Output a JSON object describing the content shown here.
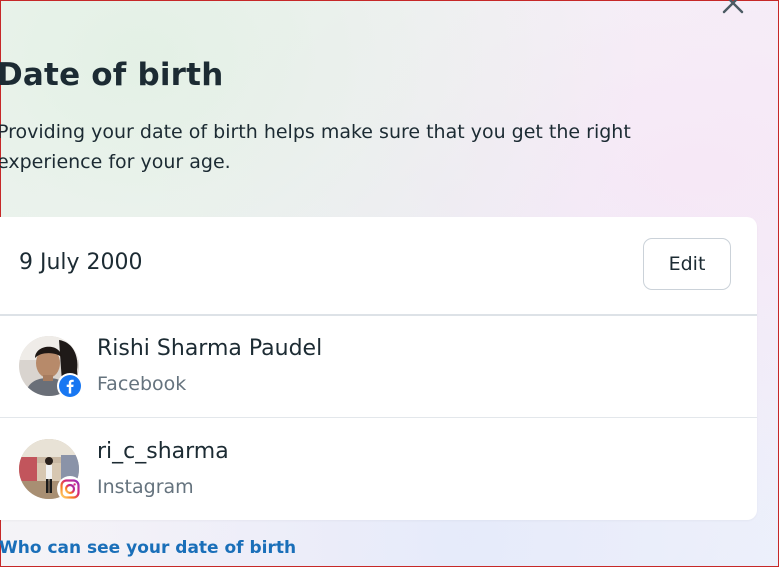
{
  "dialog": {
    "title": "Date of birth",
    "description": "Providing your date of birth helps make sure that you get the right experience for your age.",
    "close_icon": "close-icon"
  },
  "dob": {
    "value": "9 July 2000",
    "edit_label": "Edit"
  },
  "accounts": [
    {
      "name": "Rishi Sharma Paudel",
      "platform": "Facebook",
      "badge_icon": "facebook-icon"
    },
    {
      "name": "ri_c_sharma",
      "platform": "Instagram",
      "badge_icon": "instagram-icon"
    }
  ],
  "footer": {
    "link_label": "Who can see your date of birth"
  },
  "colors": {
    "text": "#1c2b33",
    "muted": "#65737e",
    "link": "#1a6fb9",
    "facebook": "#1877f2",
    "instagram": "#e1306c",
    "window_border": "#c62828"
  }
}
